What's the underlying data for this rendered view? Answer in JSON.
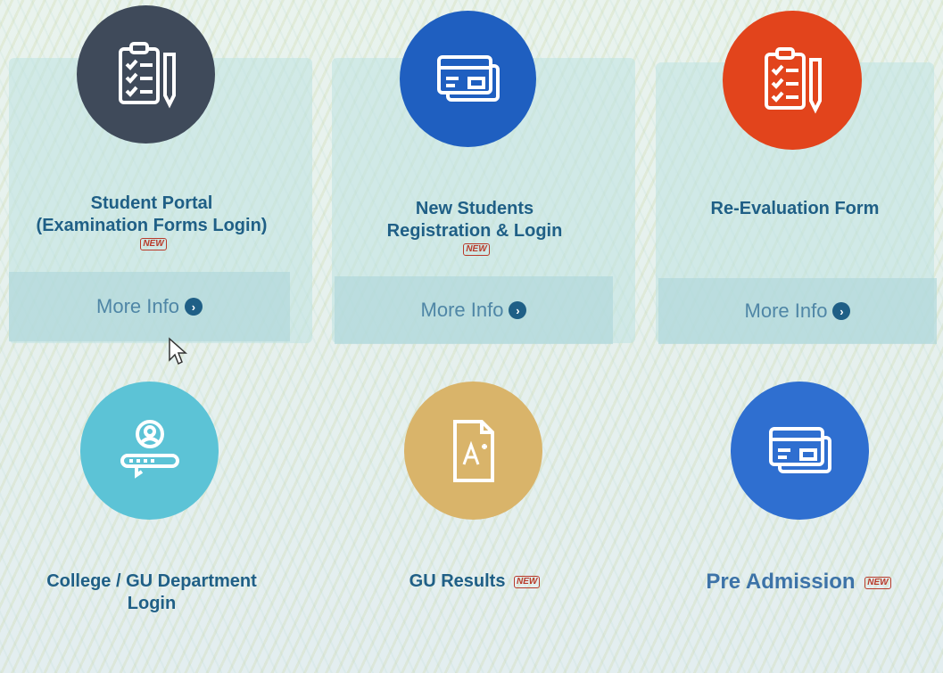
{
  "tiles": [
    {
      "title_line1": "Student Portal",
      "title_line2": "(Examination Forms Login)",
      "badge": "NEW",
      "more": "More Info",
      "icon": "clipboard-checklist-icon",
      "color": "#3f4a5a"
    },
    {
      "title_line1": "New Students",
      "title_line2": "Registration & Login",
      "badge": "NEW",
      "more": "More Info",
      "icon": "id-card-icon",
      "color": "#1f5fc0"
    },
    {
      "title_line1": "Re-Evaluation Form",
      "title_line2": "",
      "badge": "",
      "more": "More Info",
      "icon": "clipboard-checklist-icon",
      "color": "#e2441c"
    },
    {
      "title_line1": "College / GU Department",
      "title_line2": "Login",
      "badge": "",
      "more": "",
      "icon": "user-login-icon",
      "color": "#5cc3d6"
    },
    {
      "title_line1": "GU Results",
      "title_line2": "",
      "badge": "NEW",
      "more": "",
      "icon": "grade-document-icon",
      "color": "#d9b46a"
    },
    {
      "title_line1": "Pre Admission",
      "title_line2": "",
      "badge": "NEW",
      "more": "",
      "icon": "id-card-icon",
      "color": "#2f6fd0"
    }
  ]
}
